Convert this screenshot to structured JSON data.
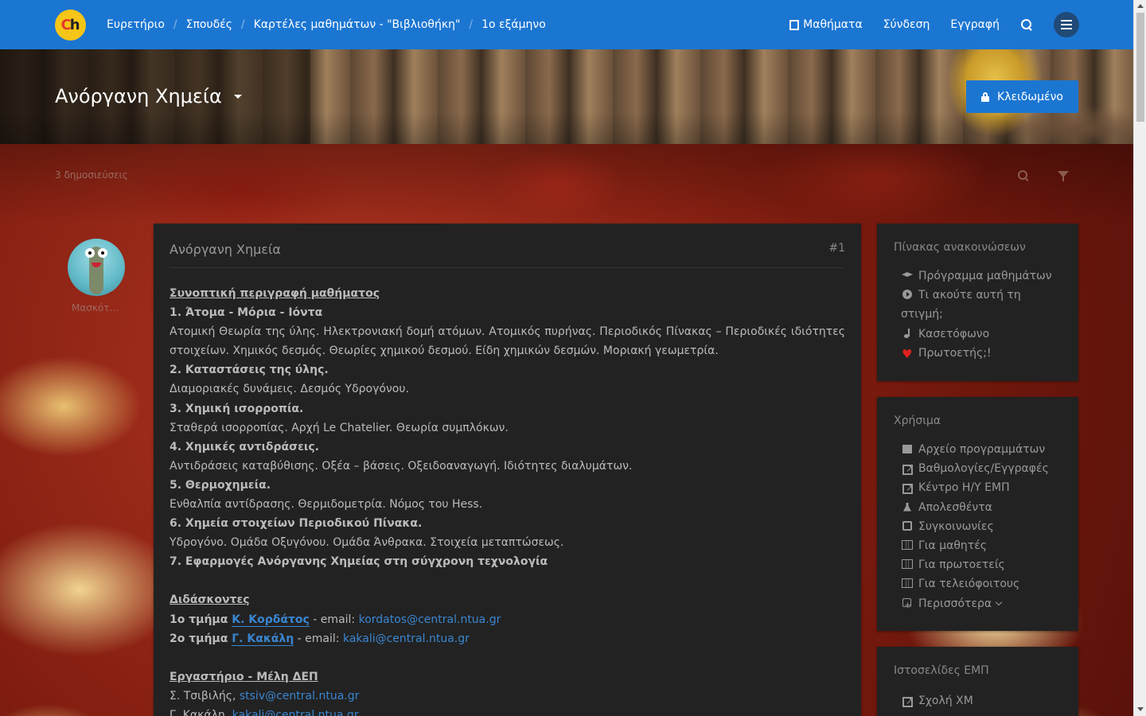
{
  "navbar": {
    "logo_text": "Ch",
    "breadcrumbs": [
      {
        "label": "Ευρετήριο"
      },
      {
        "label": "Σπουδές"
      },
      {
        "label": "Καρτέλες μαθημάτων - \"Βιβλιοθήκη\""
      },
      {
        "label": "1ο εξάμηνο"
      }
    ],
    "courses_label": "Μαθήματα",
    "login_label": "Σύνδεση",
    "register_label": "Εγγραφή"
  },
  "header": {
    "title": "Ανόργανη Χημεία",
    "locked_label": "Κλειδωμένο"
  },
  "topic": {
    "posts_count": "3 δημοσιεύσεις"
  },
  "post": {
    "author": "Μασκότ...",
    "title": "Ανόργανη Χημεία",
    "number": "#1",
    "summary_heading": "Συνοπτική περιγραφή μαθήματος",
    "sections": [
      {
        "heading": "1. Άτομα - Μόρια - Ιόντα",
        "text": "Ατομική Θεωρία της ύλης. Ηλεκτρονιακή δομή ατόμων. Ατομικός πυρήνας. Περιοδικός Πίνακας – Περιοδικές ιδιότητες στοιχείων. Χημικός δεσμός. Θεωρίες χημικού δεσμού. Είδη χημικών δεσμών. Μοριακή γεωμετρία."
      },
      {
        "heading": "2. Καταστάσεις της ύλης.",
        "text": "Διαμοριακές δυνάμεις. Δεσμός Υδρογόνου."
      },
      {
        "heading": "3. Χημική ισορροπία.",
        "text": "Σταθερά ισορροπίας. Αρχή Le Chatelier. Θεωρία συμπλόκων."
      },
      {
        "heading": "4. Χημικές αντιδράσεις.",
        "text": "Αντιδράσεις καταβύθισης. Οξέα – βάσεις. Οξειδοαναγωγή. Ιδιότητες διαλυμάτων."
      },
      {
        "heading": "5. Θερμοχημεία.",
        "text": "Ενθαλπία αντίδρασης. Θερμιδομετρία. Νόμος του Hess."
      },
      {
        "heading": "6. Χημεία στοιχείων Περιοδικού Πίνακα.",
        "text": "Υδρογόνο. Ομάδα Οξυγόνου. Ομάδα Άνθρακα. Στοιχεία μεταπτώσεως."
      },
      {
        "heading": "7. Εφαρμογές Ανόργανης Χημείας στη σύγχρονη τεχνολογία",
        "text": ""
      }
    ],
    "teachers_heading": "Διδάσκοντες",
    "teachers": [
      {
        "group": "1ο τμήμα",
        "name": "Κ. Κορδάτος",
        "email_label": " - email: ",
        "email": "kordatos@central.ntua.gr"
      },
      {
        "group": "2ο τμήμα",
        "name": "Γ. Κακάλη",
        "email_label": " - email: ",
        "email": "kakali@central.ntua.gr"
      }
    ],
    "lab_heading": "Εργαστήριο - Μέλη ΔΕΠ",
    "lab": [
      {
        "name": "Σ. Τσιβιλής, ",
        "email": "stsiv@central.ntua.gr"
      },
      {
        "name": "Γ. Κακάλη, ",
        "email": "kakali@central.ntua.gr"
      }
    ]
  },
  "sidebar": {
    "announcements": {
      "title": "Πίνακας ανακοινώσεων",
      "items": [
        {
          "icon": "graduation-cap-icon",
          "label": "Πρόγραμμα μαθημάτων"
        },
        {
          "icon": "play-circle-icon",
          "label": "Τι ακούτε αυτή τη στιγμή;"
        },
        {
          "icon": "music-icon",
          "label": "Κασετόφωνο"
        },
        {
          "icon": "heart-icon",
          "label": "Πρωτοετής;!",
          "color": "#e02020"
        }
      ]
    },
    "useful": {
      "title": "Χρήσιμα",
      "items": [
        {
          "icon": "archive-icon",
          "label": "Αρχείο προγραμμάτων"
        },
        {
          "icon": "external-link-icon",
          "label": "Βαθμολογίες/Εγγραφές"
        },
        {
          "icon": "external-link-icon",
          "label": "Κέντρο Η/Υ ΕΜΠ"
        },
        {
          "icon": "flask-icon",
          "label": "Απολεσθέντα"
        },
        {
          "icon": "bus-icon",
          "label": "Συγκοινωνίες"
        },
        {
          "icon": "map-icon",
          "label": "Για μαθητές"
        },
        {
          "icon": "map-icon",
          "label": "Για πρωτοετείς"
        },
        {
          "icon": "map-icon",
          "label": "Για τελειόφοιτους"
        },
        {
          "icon": "plus-square-icon",
          "label": "Περισσότερα"
        }
      ]
    },
    "websites": {
      "title": "Ιστοσελίδες ΕΜΠ",
      "items": [
        {
          "icon": "external-link-icon",
          "label": "Σχολή ΧΜ"
        }
      ]
    }
  },
  "colors": {
    "accent": "#1b76d2",
    "panel": "#222222",
    "link": "#3a86d0"
  }
}
